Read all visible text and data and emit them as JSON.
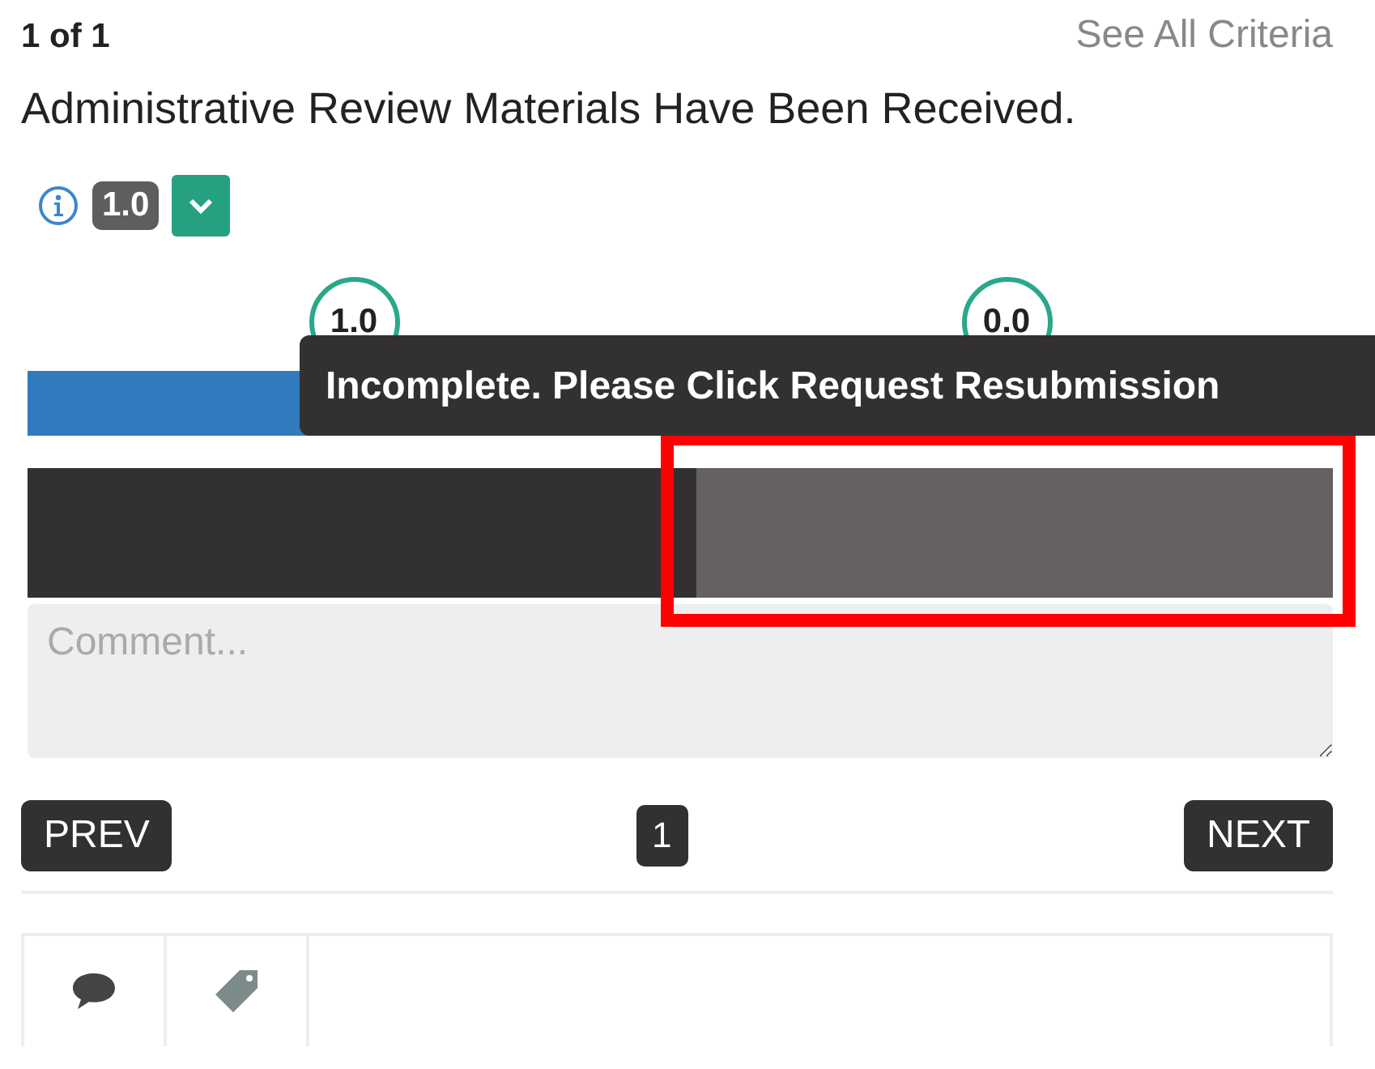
{
  "header": {
    "counter": "1 of 1",
    "link": "See All Criteria"
  },
  "criterion": {
    "title": "Administrative Review Materials Have Been Received.",
    "score": "1.0"
  },
  "scale": [
    {
      "label": "1.0"
    },
    {
      "label": "0.0"
    }
  ],
  "tooltip": "Incomplete. Please Click Request Resubmission",
  "segments": [
    {
      "selected": false,
      "highlighted": false
    },
    {
      "selected": true,
      "highlighted": true
    }
  ],
  "comment": {
    "placeholder": "Comment..."
  },
  "pagination": {
    "prev": "PREV",
    "page": "1",
    "next": "NEXT"
  },
  "tabs": [
    {
      "kind": "comment"
    },
    {
      "kind": "tag"
    }
  ]
}
